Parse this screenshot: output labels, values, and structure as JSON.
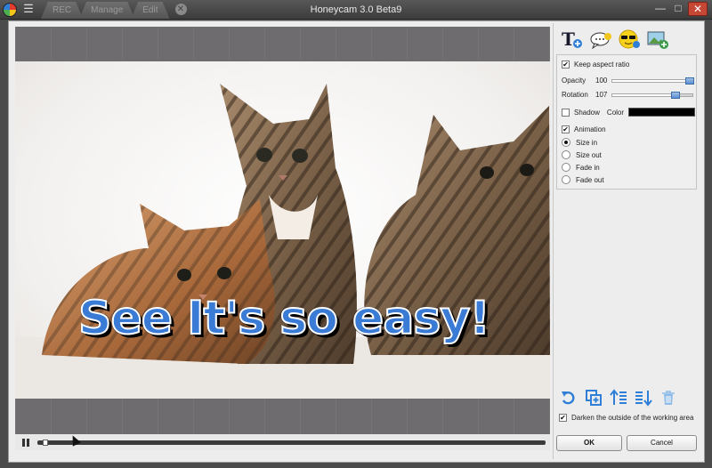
{
  "window": {
    "title": "Honeycam 3.0 Beta9",
    "tabs": [
      "REC",
      "Manage",
      "Edit"
    ],
    "controls": {
      "minimize": "—",
      "maximize": "□",
      "close": "✕"
    }
  },
  "canvas": {
    "caption": "See It's so easy!"
  },
  "playback": {
    "progress": 0.01
  },
  "panel": {
    "keep_aspect_ratio": {
      "label": "Keep aspect ratio",
      "checked": true
    },
    "opacity": {
      "label": "Opacity",
      "value": "100",
      "fraction": 1.0
    },
    "rotation": {
      "label": "Rotation",
      "value": "107",
      "fraction": 0.8
    },
    "shadow": {
      "label": "Shadow",
      "checked": false
    },
    "color": {
      "label": "Color",
      "value": "#000000"
    },
    "animation": {
      "label": "Animation",
      "checked": true,
      "options": [
        {
          "label": "Size in",
          "selected": true
        },
        {
          "label": "Size out",
          "selected": false
        },
        {
          "label": "Fade in",
          "selected": false
        },
        {
          "label": "Fade out",
          "selected": false
        }
      ]
    },
    "tools": [
      "add-text-icon",
      "speech-bubble-icon",
      "emoji-sunglasses-icon",
      "add-image-icon"
    ],
    "actions": [
      "undo-icon",
      "duplicate-icon",
      "bring-forward-icon",
      "send-backward-icon",
      "delete-icon"
    ],
    "darken": {
      "label": "Darken the outside of the working area",
      "checked": true
    },
    "ok_label": "OK",
    "cancel_label": "Cancel"
  },
  "colors": {
    "caption_fill": "#3a7bd5",
    "accent": "#2f7fd8",
    "workarea": "#6f6c6f"
  }
}
